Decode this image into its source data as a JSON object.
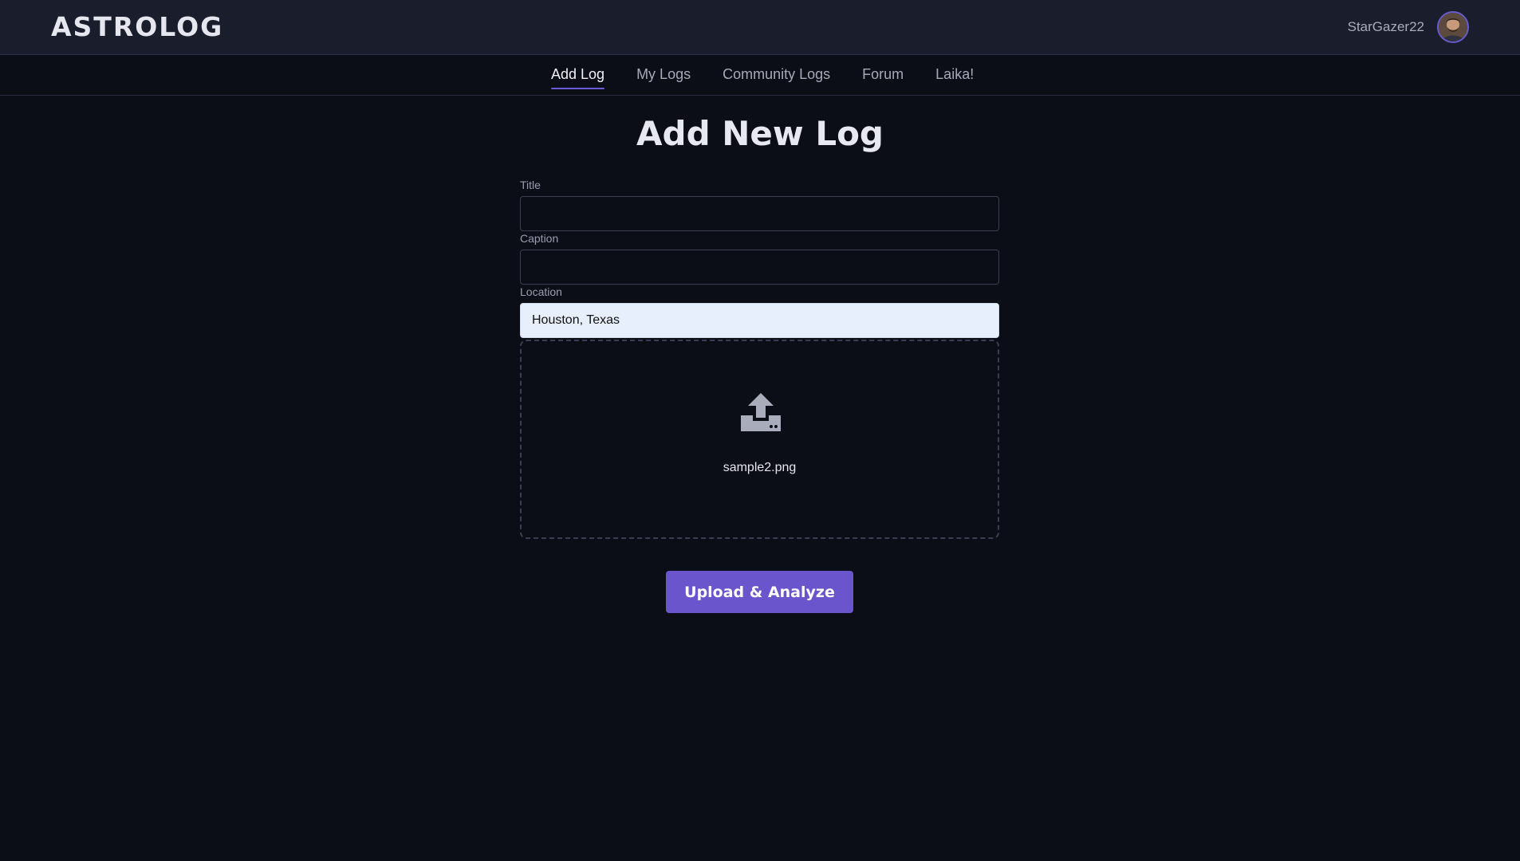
{
  "header": {
    "logo": "ASTROLOG",
    "username": "StarGazer22",
    "avatar_icon": "user-avatar"
  },
  "nav": {
    "items": [
      {
        "label": "Add Log",
        "active": true
      },
      {
        "label": "My Logs",
        "active": false
      },
      {
        "label": "Community Logs",
        "active": false
      },
      {
        "label": "Forum",
        "active": false
      },
      {
        "label": "Laika!",
        "active": false
      }
    ]
  },
  "main": {
    "title": "Add New Log",
    "form": {
      "title_label": "Title",
      "title_value": "",
      "caption_label": "Caption",
      "caption_value": "",
      "location_label": "Location",
      "location_value": "Houston, Texas",
      "upload": {
        "icon": "upload-icon",
        "file_name": "sample2.png"
      },
      "submit_label": "Upload & Analyze"
    }
  },
  "colors": {
    "accent": "#6a55cc",
    "background": "#0c0e17",
    "header": "#1a1d2c"
  }
}
